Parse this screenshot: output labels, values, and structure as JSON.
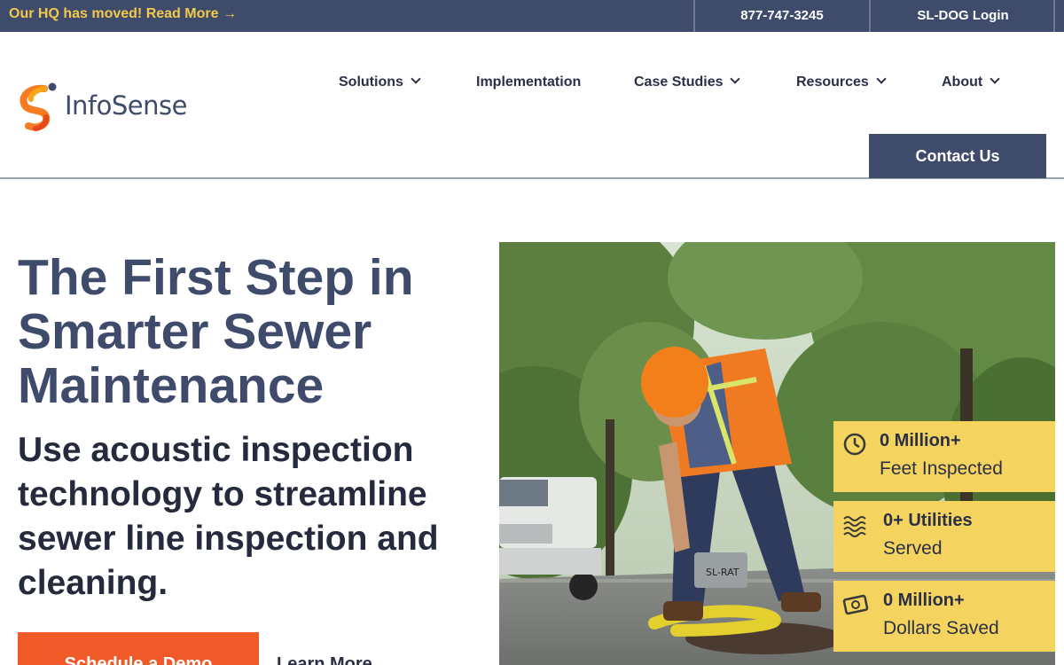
{
  "topbar": {
    "announcement": "Our HQ has moved! Read More →",
    "phone": "877-747-3245",
    "login": "SL-DOG Login"
  },
  "brand": {
    "name": "InfoSense"
  },
  "nav": {
    "items": [
      {
        "label": "Solutions",
        "dropdown": true
      },
      {
        "label": "Implementation",
        "dropdown": false
      },
      {
        "label": "Case Studies",
        "dropdown": true
      },
      {
        "label": "Resources",
        "dropdown": true
      },
      {
        "label": "About",
        "dropdown": true
      }
    ],
    "contact": "Contact Us"
  },
  "hero": {
    "title": "The First Step in Smarter Sewer Maintenance",
    "subtitle": "Use acoustic inspection technology to streamline sewer line inspection and cleaning.",
    "cta_primary": "Schedule a Demo",
    "cta_secondary": "Learn More"
  },
  "photo": {
    "device_label": "SL-RAT"
  },
  "stats": [
    {
      "icon": "clock-icon",
      "value": "0  Million+",
      "label": "Feet Inspected"
    },
    {
      "icon": "waves-icon",
      "value": "0+ Utilities",
      "label": "Served"
    },
    {
      "icon": "money-icon",
      "value": "0 Million+",
      "label": "Dollars Saved"
    }
  ],
  "colors": {
    "navy": "#3f4b6b",
    "accent_yellow": "#f2c94c",
    "stat_yellow": "#f4d45e",
    "cta_orange": "#f05a28"
  }
}
